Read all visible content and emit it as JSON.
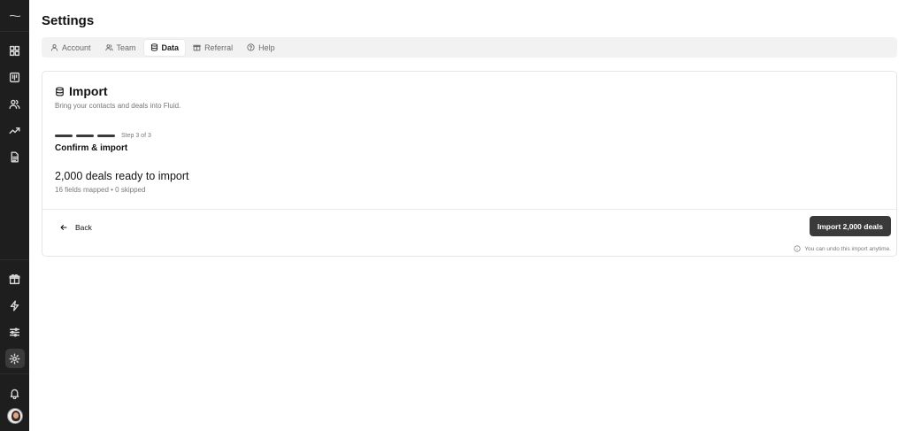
{
  "sidebar": {
    "top_icons": [
      "dashboard-icon",
      "kanban-icon",
      "users-icon",
      "trending-icon",
      "document-icon"
    ],
    "bottom_icons": [
      "gift-icon",
      "lightning-icon",
      "sliders-icon",
      "gear-icon"
    ],
    "active_icon": "gear-icon"
  },
  "page": {
    "title": "Settings"
  },
  "tabs": [
    {
      "label": "Account",
      "icon": "user-icon"
    },
    {
      "label": "Team",
      "icon": "team-icon"
    },
    {
      "label": "Data",
      "icon": "database-icon",
      "active": true
    },
    {
      "label": "Referral",
      "icon": "gift-icon"
    },
    {
      "label": "Help",
      "icon": "help-icon"
    }
  ],
  "import": {
    "title": "Import",
    "subtitle": "Bring your contacts and deals into Fluid.",
    "step_label": "Step 3 of 3",
    "steps_total": 3,
    "steps_done": 3,
    "step_title": "Confirm & import",
    "summary_title": "2,000 deals ready to import",
    "summary_sub": "16 fields mapped • 0 skipped",
    "back_label": "Back",
    "import_button_label": "Import 2,000 deals",
    "undo_note": "You can undo this import anytime."
  },
  "colors": {
    "sidebar_bg": "#1e1e1e",
    "primary_button": "#3a3a3a",
    "tabs_bg": "#f2f2f2"
  }
}
